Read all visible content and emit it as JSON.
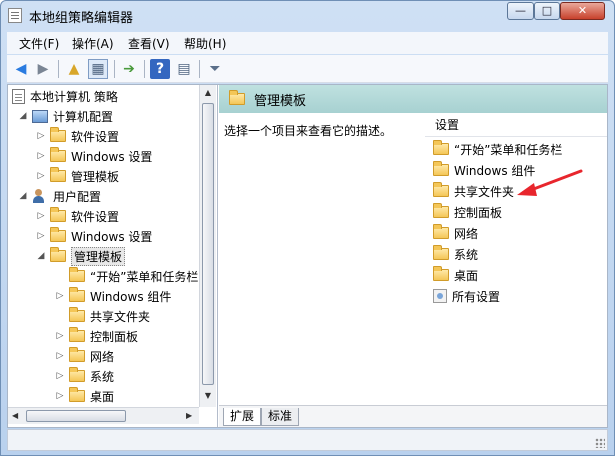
{
  "window": {
    "title": "本地组策略编辑器",
    "buttons": {
      "minimize": "—",
      "maximize": "□",
      "close": "✕"
    }
  },
  "menu": [
    {
      "label": "文件(F)"
    },
    {
      "label": "操作(A)"
    },
    {
      "label": "查看(V)"
    },
    {
      "label": "帮助(H)"
    }
  ],
  "toolbar": {
    "icons": [
      "back-icon",
      "forward-icon",
      "up-folder-icon",
      "show-hide-tree-icon",
      "export-list-icon",
      "help-icon",
      "properties-icon",
      "filter-icon"
    ]
  },
  "tree": {
    "root": "本地计算机 策略",
    "computer_config": "计算机配置",
    "software_settings_1": "软件设置",
    "windows_settings_1": "Windows 设置",
    "admin_templates_1": "管理模板",
    "user_config": "用户配置",
    "software_settings_2": "软件设置",
    "windows_settings_2": "Windows 设置",
    "admin_templates_2": "管理模板",
    "children": [
      "“开始”菜单和任务栏",
      "Windows 组件",
      "共享文件夹",
      "控制面板",
      "网络",
      "系统",
      "桌面"
    ]
  },
  "detail": {
    "title": "管理模板",
    "description": "选择一个项目来查看它的描述。",
    "column_header": "设置",
    "items": [
      "“开始”菜单和任务栏",
      "Windows 组件",
      "共享文件夹",
      "控制面板",
      "网络",
      "系统",
      "桌面",
      "所有设置"
    ]
  },
  "tabs": {
    "extended": "扩展",
    "standard": "标准"
  },
  "colors": {
    "header_bg": "#a7d1d1",
    "annotation_arrow": "#e8262d"
  }
}
